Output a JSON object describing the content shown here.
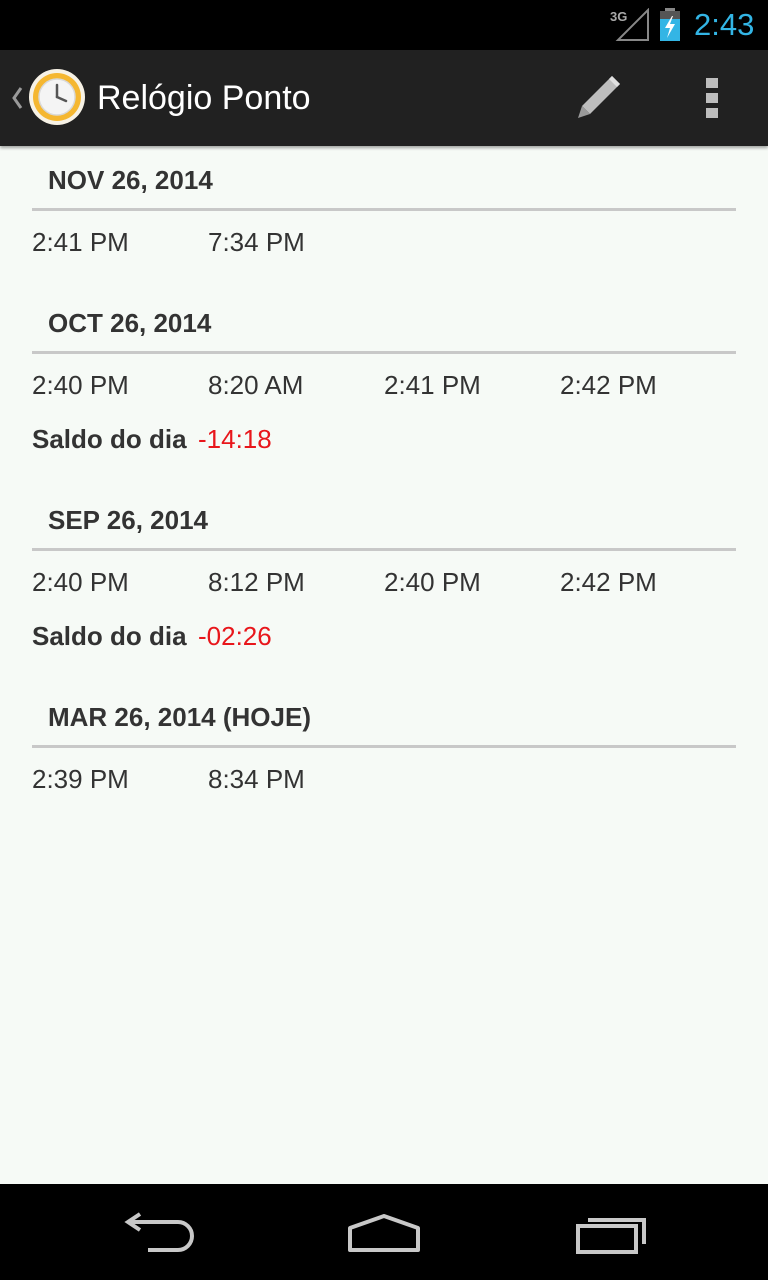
{
  "status_bar": {
    "network": "3G",
    "time": "2:43",
    "clock_color": "#33b5e5"
  },
  "action_bar": {
    "title": "Relógio Ponto",
    "icons": [
      "up-caret-icon",
      "clock-app-icon",
      "pencil-icon",
      "overflow-menu-icon"
    ]
  },
  "days": [
    {
      "date": "NOV 26, 2014",
      "times": [
        "2:41 PM",
        "7:34 PM"
      ]
    },
    {
      "date": "OCT 26, 2014",
      "times": [
        "2:40 PM",
        "8:20 AM",
        "2:41 PM",
        "2:42 PM"
      ],
      "saldo_label": "Saldo do dia",
      "saldo_value": "-14:18"
    },
    {
      "date": "SEP 26, 2014",
      "times": [
        "2:40 PM",
        "8:12 PM",
        "2:40 PM",
        "2:42 PM"
      ],
      "saldo_label": "Saldo do dia",
      "saldo_value": "-02:26"
    },
    {
      "date": "MAR 26, 2014 (HOJE)",
      "times": [
        "2:39 PM",
        "8:34 PM"
      ]
    }
  ],
  "colors": {
    "negative_balance": "#e8161b",
    "action_bar": "#212121",
    "background": "#f6faf6"
  },
  "nav_bar": {
    "icons": [
      "back-icon",
      "home-icon",
      "recent-apps-icon"
    ]
  }
}
